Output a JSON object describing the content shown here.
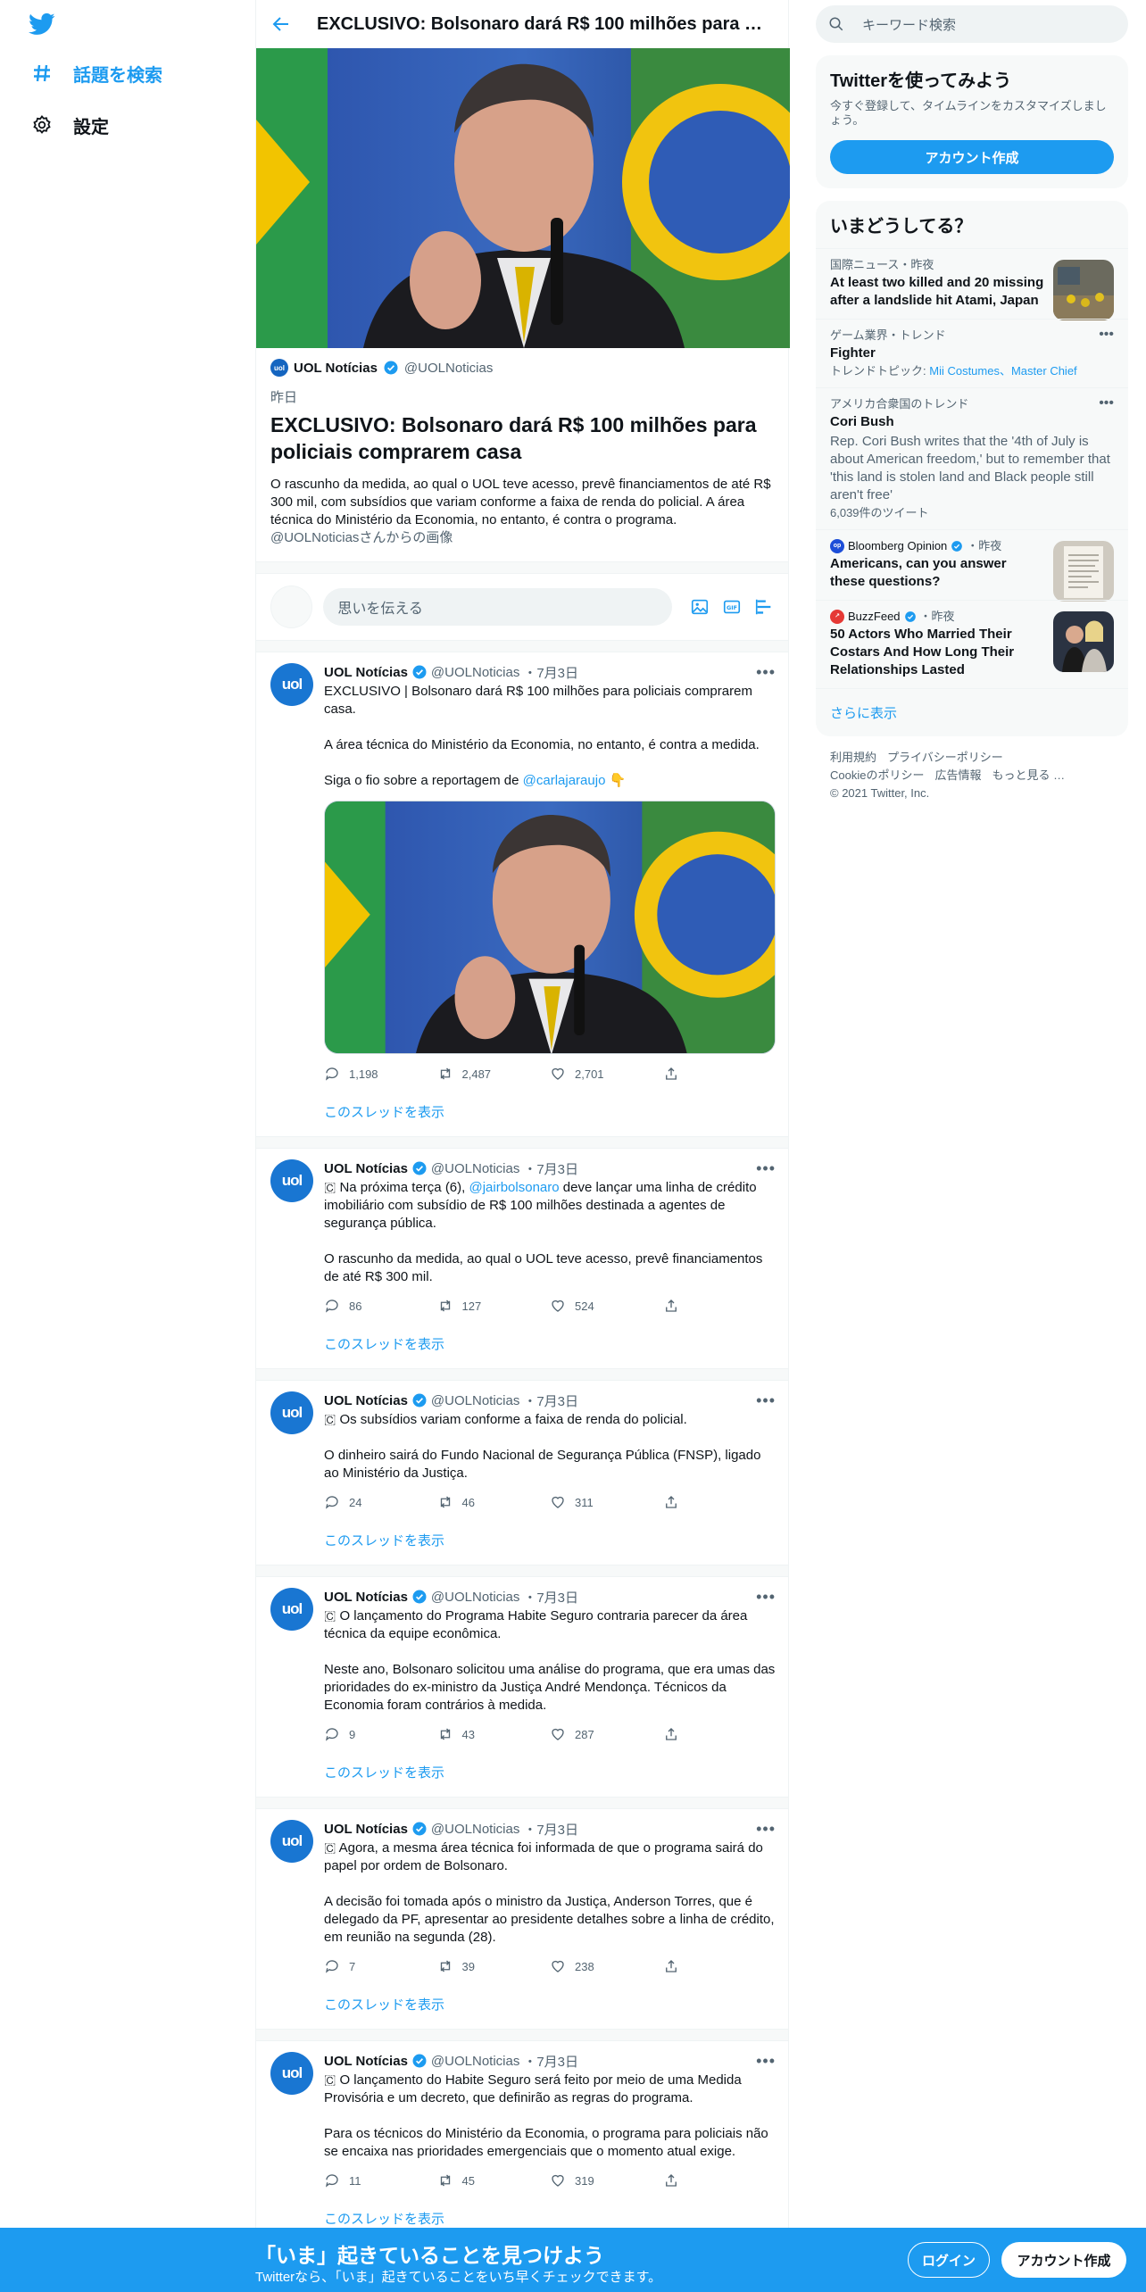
{
  "nav": {
    "explore_label": "話題を検索",
    "settings_label": "設定"
  },
  "header": {
    "title": "EXCLUSIVO: Bolsonaro dará R$ 100 milhões para policiais comprarem casa"
  },
  "card": {
    "author_name": "UOL Notícias",
    "author_handle": "@UOLNoticias",
    "date": "昨日",
    "title": "EXCLUSIVO: Bolsonaro dará R$ 100 milhões para policiais comprarem casa",
    "description": "O rascunho da medida, ao qual o UOL teve acesso, prevê financiamentos de até R$ 300 mil, com subsídios que variam conforme a faixa de renda do policial. A área técnica do Ministério da Economia, no entanto, é contra o programa.",
    "credit": "@UOLNoticiasさんからの画像"
  },
  "composer": {
    "placeholder": "思いを伝える"
  },
  "tweets": [
    {
      "name": "UOL Notícias",
      "handle": "@UOLNoticias",
      "time": "・7月3日",
      "text_a": "EXCLUSIVO | Bolsonaro dará R$ 100 milhões para policiais comprarem casa.\n\nA área técnica do Ministério da Economia, no entanto, é contra a medida.\n\nSiga o fio sobre a reportagem de ",
      "mention": "@carlajaraujo",
      "text_b": " 👇",
      "replies": "1,198",
      "retweets": "2,487",
      "likes": "2,701",
      "thread": "このスレッドを表示"
    },
    {
      "name": "UOL Notícias",
      "handle": "@UOLNoticias",
      "time": "・7月3日",
      "text_a": "🇨 Na próxima terça (6), ",
      "mention": "@jairbolsonaro",
      "text_b": " deve lançar uma linha de crédito imobiliário com subsídio de R$ 100 milhões destinada a agentes de segurança pública.\n\nO rascunho da medida, ao qual o UOL teve acesso, prevê financiamentos de até R$ 300 mil.",
      "replies": "86",
      "retweets": "127",
      "likes": "524",
      "thread": "このスレッドを表示"
    },
    {
      "name": "UOL Notícias",
      "handle": "@UOLNoticias",
      "time": "・7月3日",
      "text": "🇨 Os subsídios variam conforme a faixa de renda do policial.\n\nO dinheiro sairá do Fundo Nacional de Segurança Pública (FNSP), ligado ao Ministério da Justiça.",
      "replies": "24",
      "retweets": "46",
      "likes": "311",
      "thread": "このスレッドを表示"
    },
    {
      "name": "UOL Notícias",
      "handle": "@UOLNoticias",
      "time": "・7月3日",
      "text": "🇨 O lançamento do Programa Habite Seguro contraria parecer da área técnica da equipe econômica.\n\nNeste ano, Bolsonaro solicitou uma análise do programa, que era umas das prioridades do ex-ministro da Justiça André Mendonça. Técnicos da Economia foram contrários à medida.",
      "replies": "9",
      "retweets": "43",
      "likes": "287",
      "thread": "このスレッドを表示"
    },
    {
      "name": "UOL Notícias",
      "handle": "@UOLNoticias",
      "time": "・7月3日",
      "text": "🇨 Agora, a mesma área técnica foi informada de que o programa sairá do papel por ordem de Bolsonaro.\n\nA decisão foi tomada após o ministro da Justiça, Anderson Torres, que é delegado da PF, apresentar ao presidente detalhes sobre a linha de crédito, em reunião na segunda (28).",
      "replies": "7",
      "retweets": "39",
      "likes": "238",
      "thread": "このスレッドを表示"
    },
    {
      "name": "UOL Notícias",
      "handle": "@UOLNoticias",
      "time": "・7月3日",
      "text": "🇨 O lançamento do Habite Seguro será feito por meio de uma Medida Provisória e um decreto, que definirão as regras do programa.\n\nPara os técnicos do Ministério da Economia, o programa para policiais não se encaixa nas prioridades emergenciais que o momento atual exige.",
      "replies": "11",
      "retweets": "45",
      "likes": "319",
      "thread": "このスレッドを表示"
    }
  ],
  "avatar_text": "uol",
  "right": {
    "search_placeholder": "キーワード検索",
    "signup": {
      "title": "Twitterを使ってみよう",
      "text": "今すぐ登録して、タイムラインをカスタマイズしましょう。",
      "button": "アカウント作成"
    },
    "trends_title": "いまどうしてる？",
    "trends": [
      {
        "meta": "国際ニュース・昨夜",
        "title": "At least two killed and 20 missing after a landslide hit Atami, Japan"
      },
      {
        "meta": "ゲーム業界・トレンド",
        "title": "Fighter",
        "sub_prefix": "トレンドトピック: ",
        "sub_links": "Mii Costumes、Master Chief"
      },
      {
        "meta": "アメリカ合衆国のトレンド",
        "title": "Cori Bush",
        "desc": "Rep. Cori Bush writes that the '4th of July is about American freedom,' but to remember that 'this land is stolen land and Black people still aren't free'",
        "count": "6,039件のツイート"
      },
      {
        "source": "Bloomberg Opinion",
        "meta": "・昨夜",
        "title": "Americans, can you answer these questions?"
      },
      {
        "source": "BuzzFeed",
        "meta": "・昨夜",
        "title": "50 Actors Who Married Their Costars And How Long Their Relationships Lasted"
      }
    ],
    "show_more": "さらに表示",
    "footer": {
      "terms": "利用規約",
      "privacy": "プライバシーポリシー",
      "cookie": "Cookieのポリシー",
      "ads": "広告情報",
      "more": "もっと見る …",
      "copyright": "© 2021 Twitter, Inc."
    }
  },
  "bottom": {
    "title": "「いま」起きていることを見つけよう",
    "subtitle": "Twitterなら、「いま」起きていることをいち早くチェックできます。",
    "login": "ログイン",
    "signup": "アカウント作成"
  },
  "colors": {
    "accent": "#1d9bf0",
    "uol_blue": "#1976d2"
  }
}
